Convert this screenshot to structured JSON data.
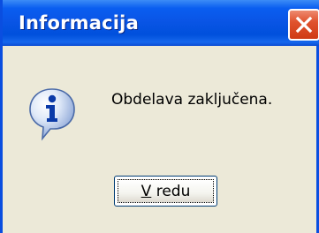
{
  "window": {
    "title": "Informacija"
  },
  "dialog": {
    "message": "Obdelava zaključena.",
    "icon": "information-icon"
  },
  "buttons": {
    "ok_access_key": "V",
    "ok_label_rest": " redu"
  },
  "colors": {
    "titlebar": "#0a55e6",
    "close_button": "#e0532e",
    "dialog_background": "#ece9d8"
  }
}
